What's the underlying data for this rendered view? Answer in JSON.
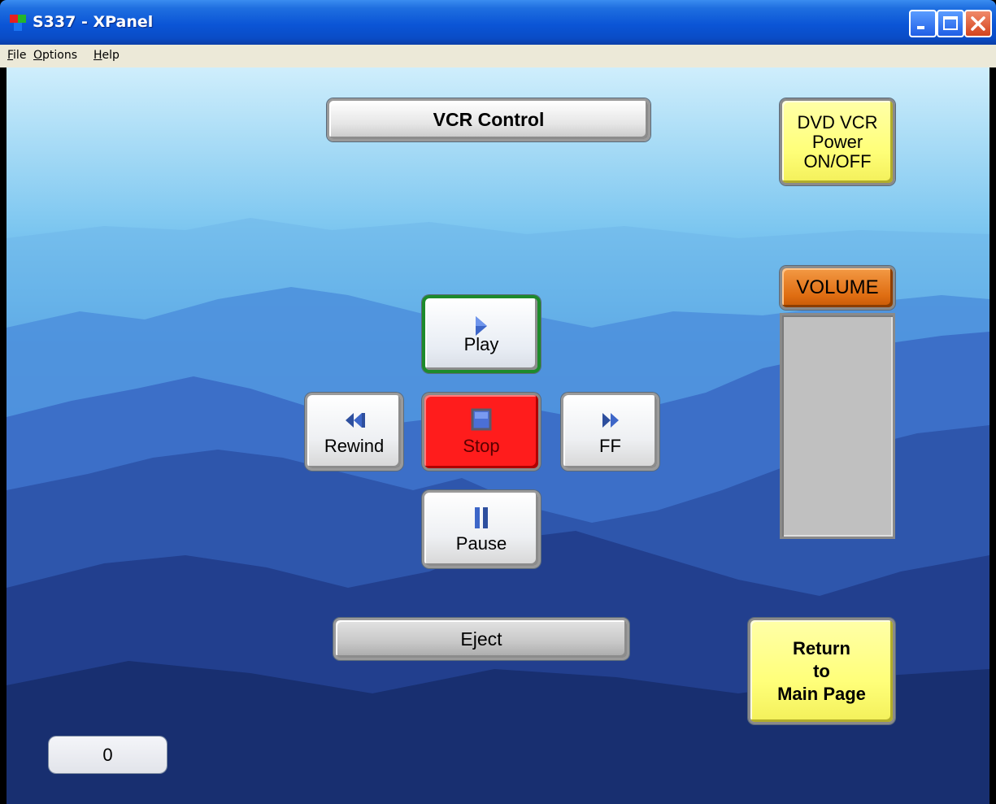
{
  "window": {
    "title": "S337 - XPanel",
    "icons": {
      "app": "xpanel-app-icon",
      "minimize": "minimize-icon",
      "maximize": "maximize-icon",
      "close": "close-icon"
    }
  },
  "menu": {
    "items": [
      {
        "label": "File",
        "accel": "F",
        "rest": "ile"
      },
      {
        "label": "Options",
        "accel": "O",
        "rest": "ptions"
      },
      {
        "label": "Help",
        "accel": "H",
        "rest": "elp"
      }
    ]
  },
  "panel": {
    "header_label": "VCR Control",
    "power_label": [
      "DVD VCR",
      "Power",
      "ON/OFF"
    ],
    "transport": {
      "play": {
        "label": "Play",
        "icon": "play-icon"
      },
      "rewind": {
        "label": "Rewind",
        "icon": "rewind-icon"
      },
      "stop": {
        "label": "Stop",
        "icon": "stop-icon"
      },
      "ff": {
        "label": "FF",
        "icon": "fast-forward-icon"
      },
      "pause": {
        "label": "Pause",
        "icon": "pause-icon"
      }
    },
    "eject_label": "Eject",
    "volume": {
      "label": "VOLUME",
      "level": 0
    },
    "return_label": [
      "Return",
      "to",
      "Main Page"
    ],
    "counter_value": "0"
  },
  "colors": {
    "play_border": "#1d8a2b",
    "stop_fill": "#ff1c1c",
    "volume_button": "#df6d12",
    "power_button": "#ffff7a",
    "gauge": "#c0c0c0"
  }
}
